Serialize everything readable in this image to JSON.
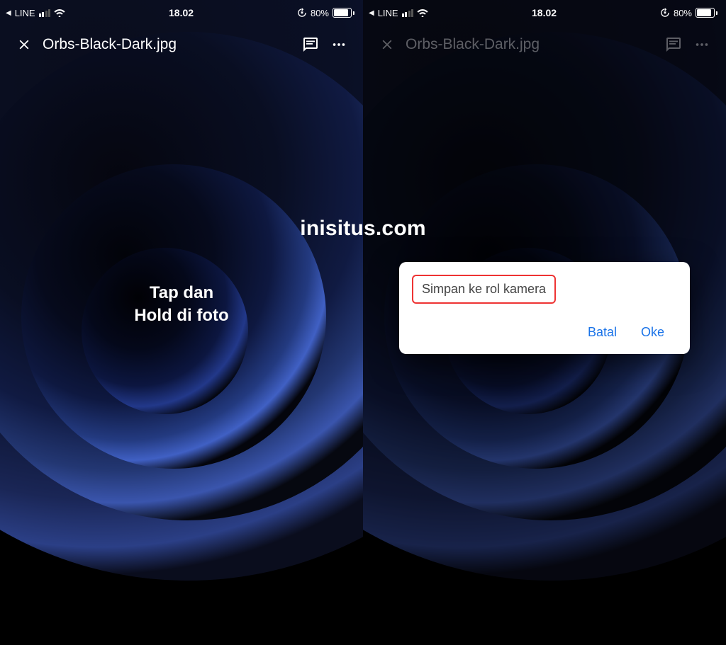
{
  "status_bar": {
    "back_app": "LINE",
    "time": "18.02",
    "battery_pct": "80%"
  },
  "header": {
    "title": "Orbs-Black-Dark.jpg"
  },
  "left_panel": {
    "instruction_line1": "Tap dan",
    "instruction_line2": "Hold di foto"
  },
  "dialog": {
    "message": "Simpan ke rol kamera",
    "cancel": "Batal",
    "ok": "Oke"
  },
  "watermark": "inisitus.com"
}
